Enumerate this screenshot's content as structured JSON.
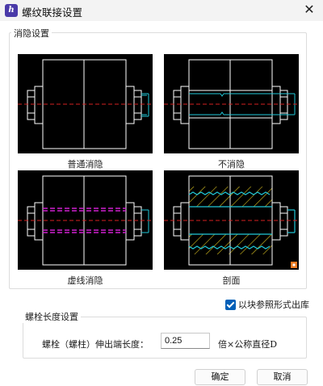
{
  "window": {
    "title": "螺纹联接设置",
    "app_icon_glyph": "h",
    "close_glyph": "✕"
  },
  "hide_group": {
    "label": "消隐设置",
    "options": [
      {
        "caption": "普通消隐"
      },
      {
        "caption": "不消隐"
      },
      {
        "caption": "虚线消隐"
      },
      {
        "caption": "剖面"
      }
    ]
  },
  "block_checkbox": {
    "label": "以块参照形式出库",
    "checked": true
  },
  "bolt_group": {
    "label": "螺栓长度设置",
    "field_label": "螺栓（螺柱）伸出端长度：",
    "field_value": "0.25",
    "unit_label": "倍×公称直径D"
  },
  "buttons": {
    "ok": "确定",
    "cancel": "取消"
  },
  "colors": {
    "accent": "#005fb8",
    "preview_bg": "#000000",
    "drawing_line": "#ffffff",
    "center_line": "#d42020",
    "thread_cyan": "#20c8d8",
    "hidden_magenta": "#d020d0",
    "hatch_yellow": "#d8c020",
    "marker_orange": "#e87820"
  }
}
